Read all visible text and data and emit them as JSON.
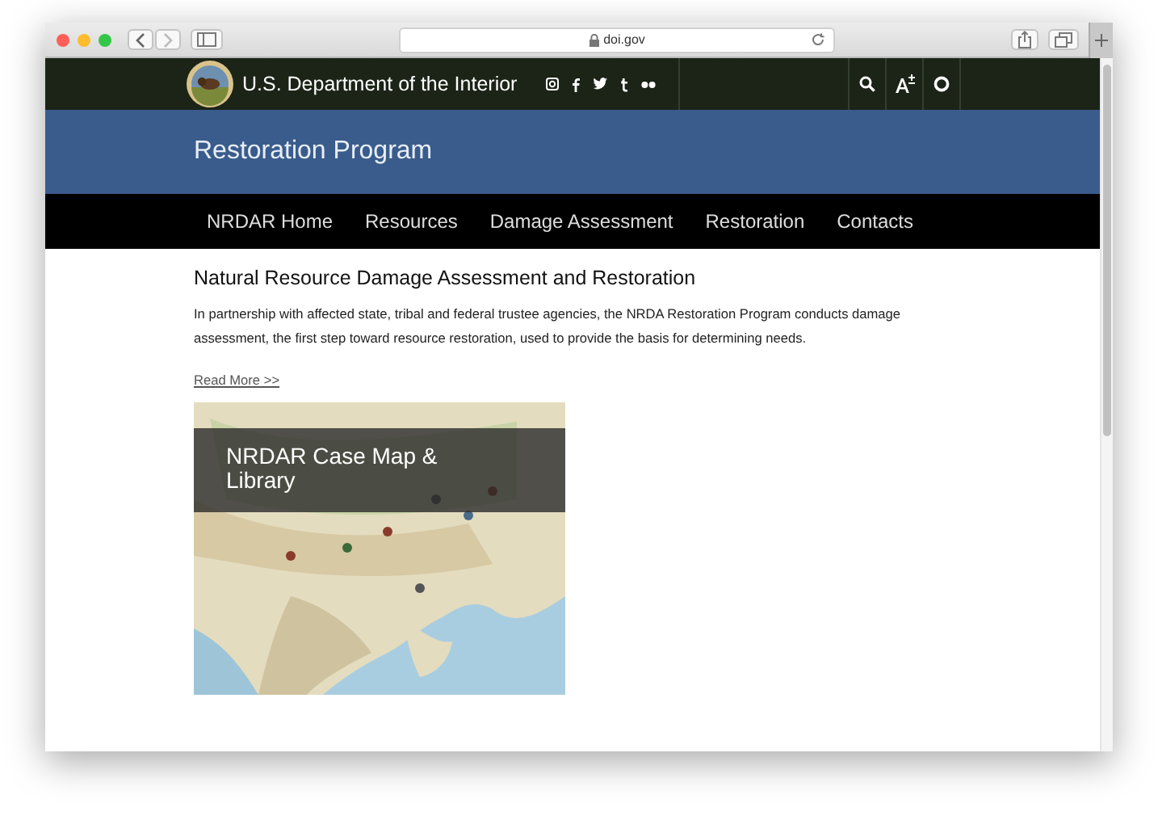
{
  "browser": {
    "address": "doi.gov"
  },
  "header": {
    "site_title": "U.S. Department of the Interior"
  },
  "banner": {
    "title": "Restoration Program"
  },
  "nav": {
    "items": [
      "NRDAR Home",
      "Resources",
      "Damage Assessment",
      "Restoration",
      "Contacts"
    ]
  },
  "content": {
    "heading": "Natural Resource Damage Assessment and Restoration",
    "paragraph": "In partnership with affected state, tribal and federal trustee agencies, the NRDA Restoration Program conducts damage assessment, the first step toward resource restoration, used to provide the basis for determining needs.",
    "link": "Read More >>",
    "card": {
      "kind": "picture",
      "title": "NRDAR Case Map & Library"
    }
  }
}
